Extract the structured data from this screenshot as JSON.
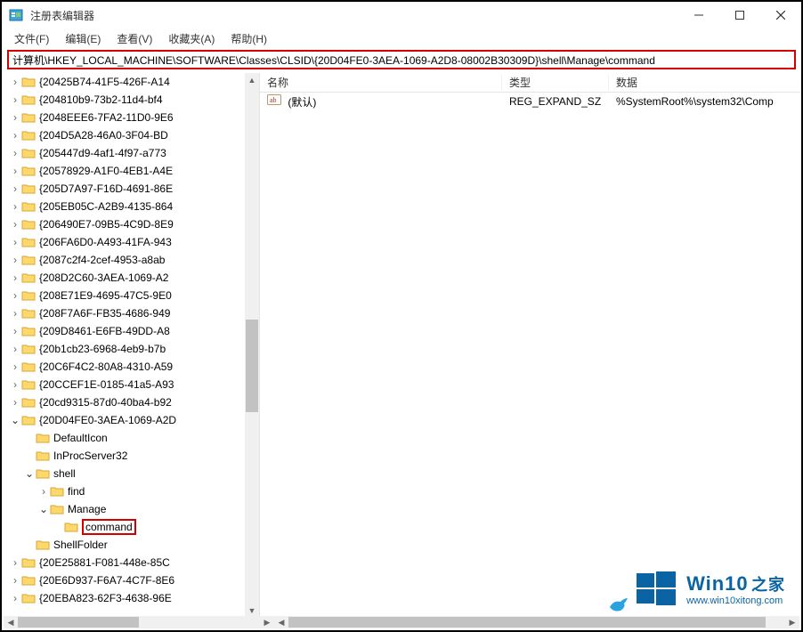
{
  "window": {
    "title": "注册表编辑器"
  },
  "menu": {
    "file": "文件(F)",
    "edit": "编辑(E)",
    "view": "查看(V)",
    "favorites": "收藏夹(A)",
    "help": "帮助(H)"
  },
  "address": {
    "path": "计算机\\HKEY_LOCAL_MACHINE\\SOFTWARE\\Classes\\CLSID\\{20D04FE0-3AEA-1069-A2D8-08002B30309D}\\shell\\Manage\\command"
  },
  "list": {
    "columns": {
      "name": "名称",
      "type": "类型",
      "data": "数据"
    },
    "row": {
      "name": "(默认)",
      "type": "REG_EXPAND_SZ",
      "data": "%SystemRoot%\\system32\\Comp"
    }
  },
  "tree": {
    "items": [
      {
        "indent": 5,
        "exp": ">",
        "label": "{20425B74-41F5-426F-A14"
      },
      {
        "indent": 5,
        "exp": ">",
        "label": "{204810b9-73b2-11d4-bf4"
      },
      {
        "indent": 5,
        "exp": ">",
        "label": "{2048EEE6-7FA2-11D0-9E6"
      },
      {
        "indent": 5,
        "exp": ">",
        "label": "{204D5A28-46A0-3F04-BD"
      },
      {
        "indent": 5,
        "exp": ">",
        "label": "{205447d9-4af1-4f97-a773"
      },
      {
        "indent": 5,
        "exp": ">",
        "label": "{20578929-A1F0-4EB1-A4E"
      },
      {
        "indent": 5,
        "exp": ">",
        "label": "{205D7A97-F16D-4691-86E"
      },
      {
        "indent": 5,
        "exp": ">",
        "label": "{205EB05C-A2B9-4135-864"
      },
      {
        "indent": 5,
        "exp": ">",
        "label": "{206490E7-09B5-4C9D-8E9"
      },
      {
        "indent": 5,
        "exp": ">",
        "label": "{206FA6D0-A493-41FA-943"
      },
      {
        "indent": 5,
        "exp": ">",
        "label": "{2087c2f4-2cef-4953-a8ab"
      },
      {
        "indent": 5,
        "exp": ">",
        "label": "{208D2C60-3AEA-1069-A2"
      },
      {
        "indent": 5,
        "exp": ">",
        "label": "{208E71E9-4695-47C5-9E0"
      },
      {
        "indent": 5,
        "exp": ">",
        "label": "{208F7A6F-FB35-4686-949"
      },
      {
        "indent": 5,
        "exp": ">",
        "label": "{209D8461-E6FB-49DD-A8"
      },
      {
        "indent": 5,
        "exp": ">",
        "label": "{20b1cb23-6968-4eb9-b7b"
      },
      {
        "indent": 5,
        "exp": ">",
        "label": "{20C6F4C2-80A8-4310-A59"
      },
      {
        "indent": 5,
        "exp": ">",
        "label": "{20CCEF1E-0185-41a5-A93"
      },
      {
        "indent": 5,
        "exp": ">",
        "label": "{20cd9315-87d0-40ba4-b92"
      },
      {
        "indent": 5,
        "exp": "v",
        "label": "{20D04FE0-3AEA-1069-A2D"
      },
      {
        "indent": 6,
        "exp": "",
        "label": "DefaultIcon"
      },
      {
        "indent": 6,
        "exp": "",
        "label": "InProcServer32"
      },
      {
        "indent": 6,
        "exp": "v",
        "label": "shell"
      },
      {
        "indent": 7,
        "exp": ">",
        "label": "find"
      },
      {
        "indent": 7,
        "exp": "v",
        "label": "Manage"
      },
      {
        "indent": 8,
        "exp": "",
        "label": "command",
        "highlight": true
      },
      {
        "indent": 6,
        "exp": "",
        "label": "ShellFolder"
      },
      {
        "indent": 5,
        "exp": ">",
        "label": "{20E25881-F081-448e-85C"
      },
      {
        "indent": 5,
        "exp": ">",
        "label": "{20E6D937-F6A7-4C7F-8E6"
      },
      {
        "indent": 5,
        "exp": ">",
        "label": "{20EBA823-62F3-4638-96E"
      }
    ]
  },
  "watermark": {
    "brand": "Win10",
    "suffix": "之家",
    "url": "www.win10xitong.com"
  }
}
